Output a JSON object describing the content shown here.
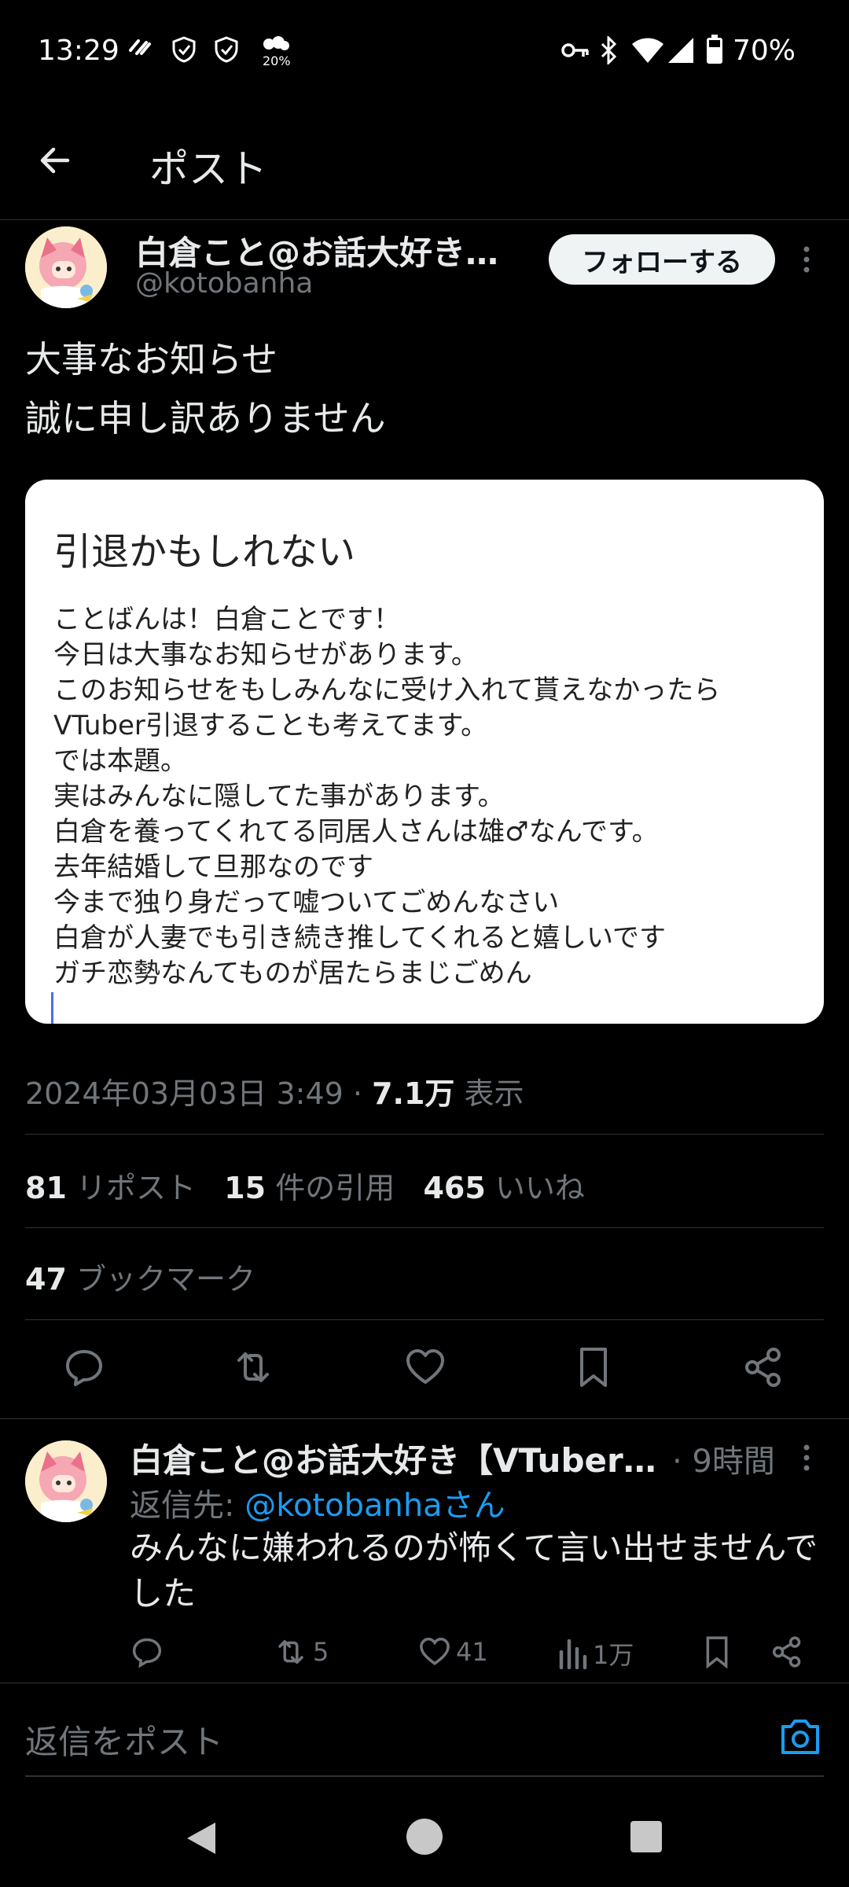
{
  "status_bar": {
    "time": "13:29",
    "battery": "70%",
    "notif_badge": "20%"
  },
  "header": {
    "title": "ポスト"
  },
  "post": {
    "author_name": "白倉こと@お話大好き【...",
    "author_handle": "@kotobanha",
    "follow_label": "フォローする",
    "text_lines": [
      "大事なお知らせ",
      "誠に申し訳ありません"
    ],
    "card": {
      "title": "引退かもしれない",
      "lines": [
        "ことばんは！白倉ことです！",
        "今日は大事なお知らせがあります。",
        "このお知らせをもしみんなに受け入れて貰えなかったら",
        "VTuber引退することも考えてます。",
        "では本題。",
        "実はみんなに隠してた事があります。",
        "白倉を養ってくれてる同居人さんは雄♂なんです。",
        "去年結婚して旦那なのです",
        "今まで独り身だって嘘ついてごめんなさい",
        "白倉が人妻でも引き続き推してくれると嬉しいです",
        "ガチ恋勢なんてものが居たらまじごめん"
      ]
    },
    "timestamp": "2024年03月03日 3:49 · ",
    "views_count": "7.1万",
    "views_label": " 表示",
    "reposts_count": "81",
    "reposts_label": " リポスト",
    "quotes_count": "15",
    "quotes_label": " 件の引用",
    "likes_count": "465",
    "likes_label": " いいね",
    "bookmarks_count": "47",
    "bookmarks_label": " ブックマーク"
  },
  "reply": {
    "author_name": "白倉こと@お話大好き【VTuber】...",
    "time": "· 9時間",
    "reply_to_prefix": "返信先: ",
    "reply_to_handle": "@kotobanhaさん",
    "text": "みんなに嫌われるのが怖くて言い出せませんでした",
    "retweets": "5",
    "likes": "41",
    "views": "1万"
  },
  "composer": {
    "placeholder": "返信をポスト"
  },
  "colors": {
    "background": "#000000",
    "accent": "#1d9bf0",
    "muted": "#71767b",
    "divider": "#2f3336"
  }
}
